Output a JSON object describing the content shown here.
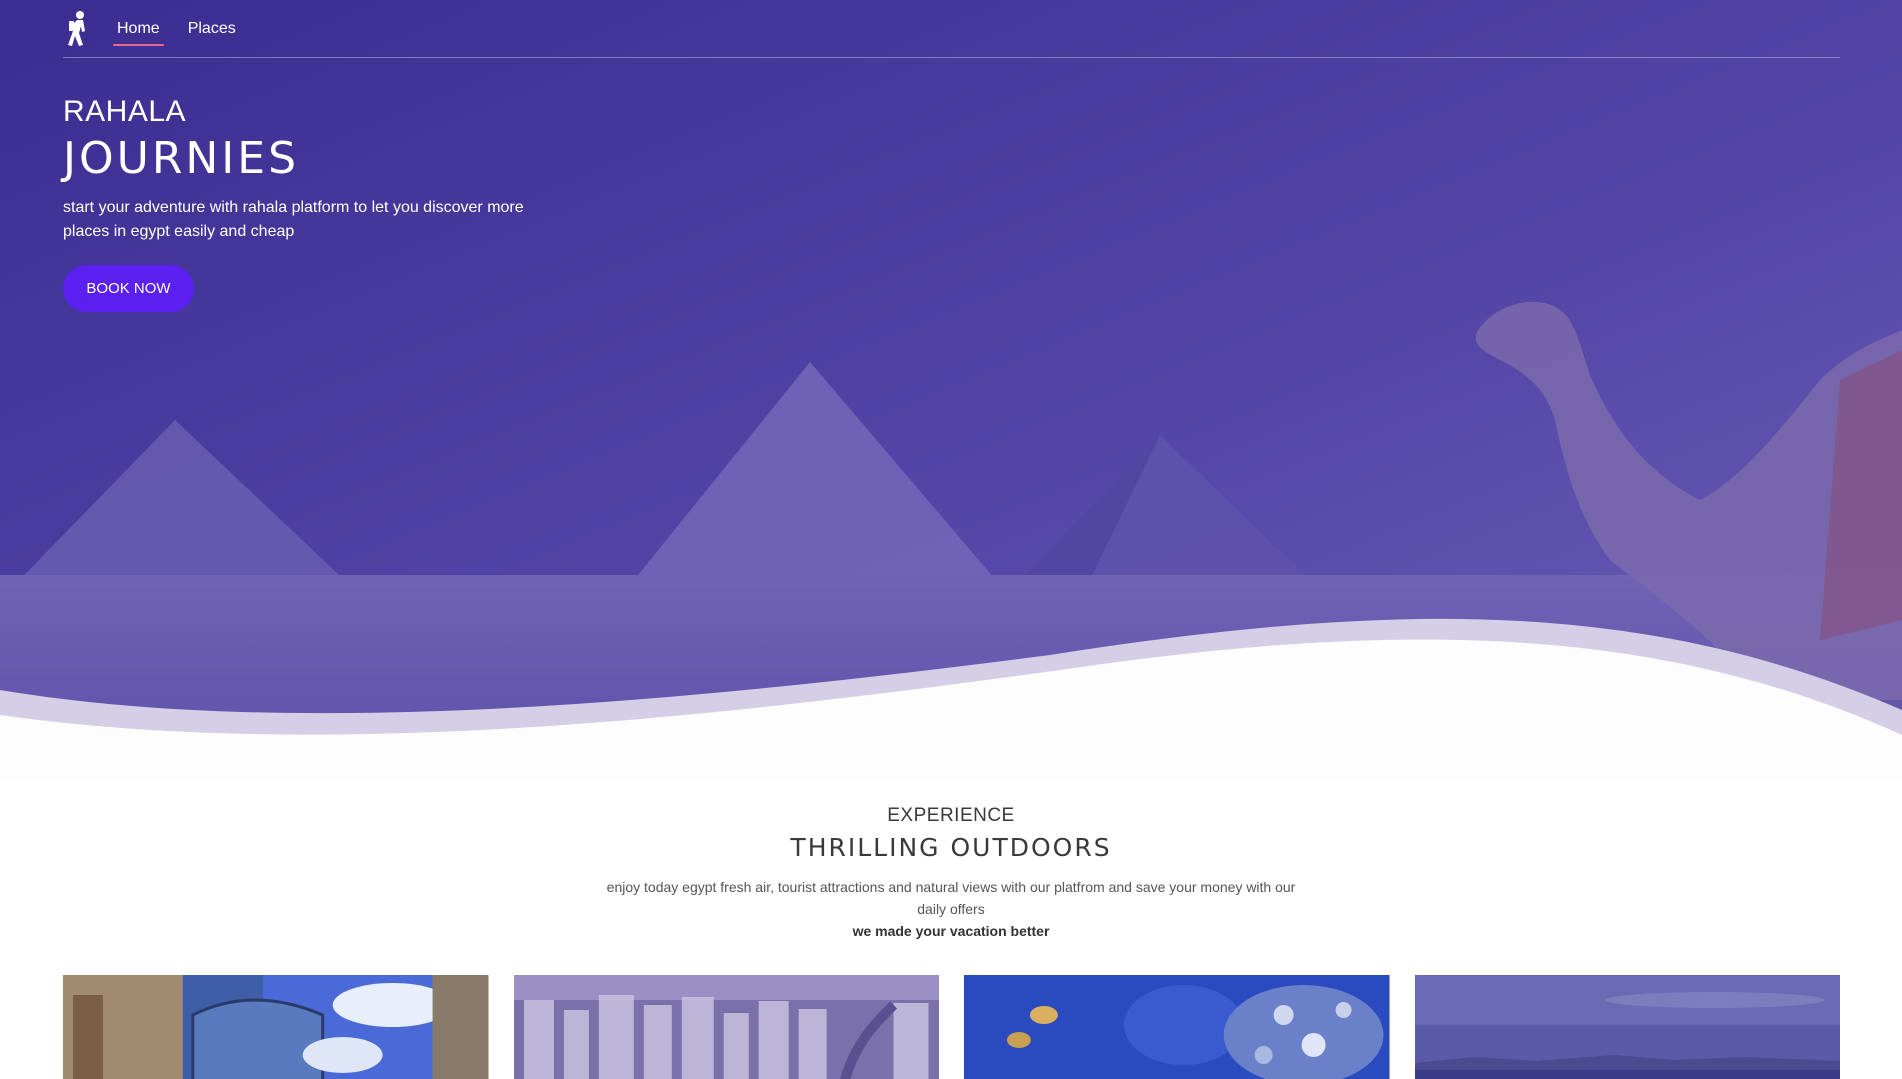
{
  "nav": {
    "logo_icon": "hiker-logo-icon",
    "links": [
      {
        "label": "Home",
        "active": true
      },
      {
        "label": "Places",
        "active": false
      }
    ]
  },
  "hero": {
    "kicker": "RAHALA",
    "title": "JOURNIES",
    "description": "start your adventure with rahala platform to let you discover more places in egypt easily and cheap",
    "cta_label": "BOOK NOW"
  },
  "experience": {
    "kicker": "EXPERIENCE",
    "title": "THRILLING OUTDOORS",
    "description": "enjoy today egypt fresh air, tourist attractions and natural views with our platfrom and save your money with our daily offers",
    "tagline": "we made your vacation better"
  },
  "colors": {
    "hero_overlay": "#4a3d9e",
    "cta": "#5b1ff0",
    "nav_active_underline": "#e46b8d"
  }
}
